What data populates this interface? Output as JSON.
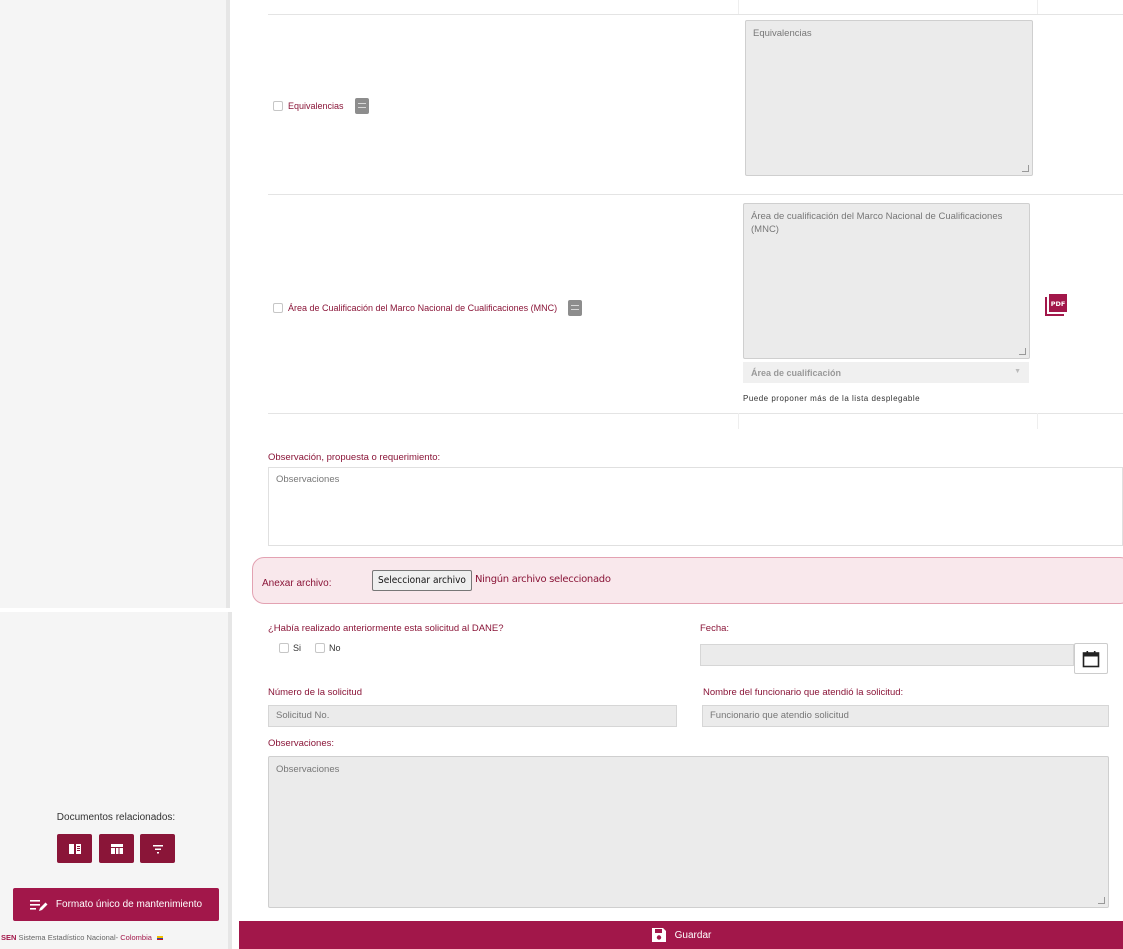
{
  "sidebar": {
    "related_docs_label": "Documentos relacionados:",
    "related_buttons": [
      "book-icon",
      "table-icon",
      "filter-icon"
    ],
    "formato_button_label": "Formato único de mantenimiento",
    "footer": {
      "brand": "SEN",
      "text": "Sistema Estadístico Nacional- ",
      "country": "Colombia"
    }
  },
  "rows": [
    {
      "label": "Equivalencias",
      "textarea_placeholder": "Equivalencias"
    },
    {
      "label": "Área de Cualificación del Marco Nacional de Cualificaciones (MNC)",
      "textarea_placeholder": "Área de cualificación del Marco Nacional de Cualificaciones (MNC)",
      "select_placeholder": "Área de cualificación",
      "hint": "Puede proponer más de la lista desplegable",
      "pdf_label": "PDF"
    }
  ],
  "observation": {
    "label": "Observación, propuesta o requerimiento:",
    "placeholder": "Observaciones"
  },
  "attach": {
    "label": "Anexar archivo:",
    "button_label": "Seleccionar archivo",
    "status": "Ningún archivo seleccionado"
  },
  "previous": {
    "question": "¿Había realizado anteriormente esta solicitud al DANE?",
    "yes_label": "Si",
    "no_label": "No",
    "date_label": "Fecha:",
    "request_number_label": "Número de la solicitud",
    "request_number_placeholder": "Solicitud No.",
    "official_label": "Nombre del funcionario que atendió la solicitud:",
    "official_placeholder": "Funcionario que atendio solicitud",
    "observations_label": "Observaciones:",
    "observations_placeholder": "Observaciones"
  },
  "save": {
    "label": "Guardar"
  },
  "colors": {
    "brand": "#a2174a",
    "brand_dark": "#8a1538",
    "attach_bg": "#f9e8ec"
  }
}
